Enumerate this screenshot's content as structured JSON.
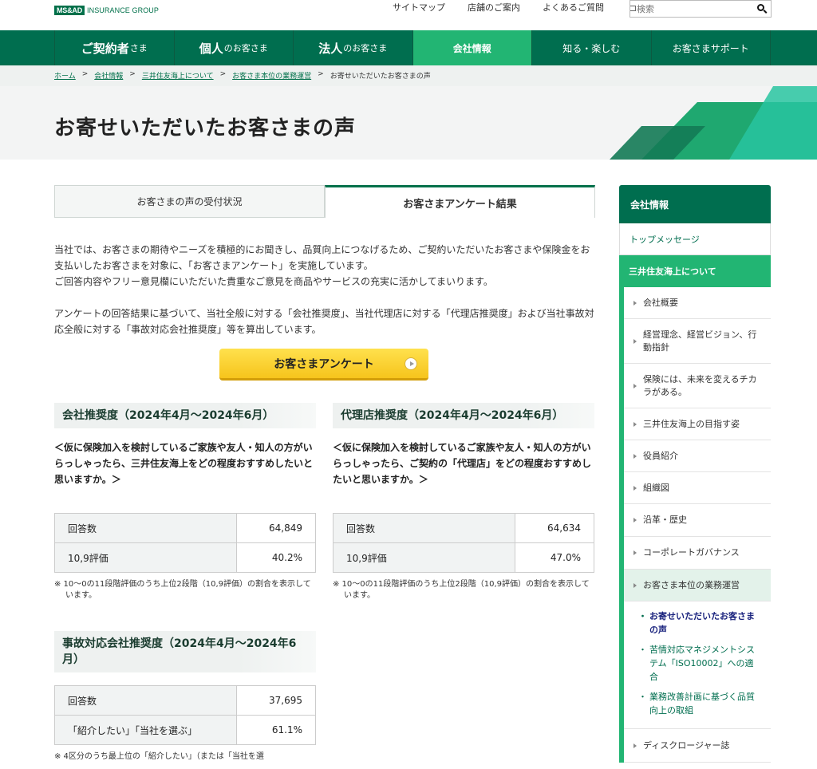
{
  "header": {
    "logo_box": "MS&AD",
    "logo_text": "INSURANCE GROUP",
    "util_links": [
      "サイトマップ",
      "店舗のご案内",
      "よくあるご質問"
    ],
    "search_placeholder": "検索"
  },
  "gnav": [
    {
      "main": "ご契約者",
      "suffix": "さま"
    },
    {
      "main": "個人",
      "suffix": "のお客さま"
    },
    {
      "main": "法人",
      "suffix": "のお客さま"
    },
    {
      "main": "会社情報",
      "suffix": ""
    },
    {
      "main": "知る・楽しむ",
      "suffix": ""
    },
    {
      "main": "お客さまサポート",
      "suffix": ""
    }
  ],
  "breadcrumb": {
    "links": [
      "ホーム",
      "会社情報",
      "三井住友海上について",
      "お客さま本位の業務運営"
    ],
    "current": "お寄せいただいたお客さまの声"
  },
  "page_title": "お寄せいただいたお客さまの声",
  "tabs": {
    "tab1": "お客さまの声の受付状況",
    "tab2": "お客さまアンケート結果"
  },
  "intro": {
    "p1a": "当社では、お客さまの期待やニーズを積極的にお聞きし、品質向上につなげるため、ご契約いただいたお客さまや保険金をお支払いしたお客さまを対象に、「お客さまアンケート」を実施しています。",
    "p1b": "ご回答内容やフリー意見欄にいただいた貴重なご意見を商品やサービスの充実に活かしてまいります。",
    "p2": "アンケートの回答結果に基づいて、当社全般に対する「会社推奨度」、当社代理店に対する「代理店推奨度」および当社事故対応全般に対する「事故対応会社推奨度」等を算出しています。"
  },
  "cta_label": "お客さまアンケート",
  "blocks": {
    "company": {
      "title": "会社推奨度（2024年4月～2024年6月）",
      "question": "＜仮に保険加入を検討しているご家族や友人・知人の方がいらっしゃったら、三井住友海上をどの程度おすすめしたいと思いますか。＞",
      "row1_label": "回答数",
      "row1_value": "64,849",
      "row2_label": "10,9評価",
      "row2_value": "40.2%",
      "note": "※ 10～0の11段階評価のうち上位2段階（10,9評価）の割合を表示しています。"
    },
    "agency": {
      "title": "代理店推奨度（2024年4月～2024年6月）",
      "question": "＜仮に保険加入を検討しているご家族や友人・知人の方がいらっしゃったら、ご契約の「代理店」をどの程度おすすめしたいと思いますか。＞",
      "row1_label": "回答数",
      "row1_value": "64,634",
      "row2_label": "10,9評価",
      "row2_value": "47.0%",
      "note": "※ 10～0の11段階評価のうち上位2段階（10,9評価）の割合を表示しています。"
    },
    "accident": {
      "title": "事故対応会社推奨度（2024年4月～2024年6月）",
      "row1_label": "回答数",
      "row1_value": "37,695",
      "row2_label": "「紹介したい」「当社を選ぶ」",
      "row2_value": "61.1%",
      "note": "※ 4区分のうち最上位の「紹介したい」（または「当社を選"
    }
  },
  "sidebar": {
    "head": "会社情報",
    "top": "トップメッセージ",
    "section": "三井住友海上について",
    "items": [
      "会社概要",
      "経営理念、経営ビジョン、行動指針",
      "保険には、未来を変えるチカラがある。",
      "三井住友海上の目指す姿",
      "役員紹介",
      "組織図",
      "沿革・歴史",
      "コーポレートガバナンス",
      "お客さま本位の業務運営"
    ],
    "sub": [
      "お寄せいただいたお客さまの声",
      "苦情対応マネジメントシステム「ISO10002」への適合",
      "業務改善計画に基づく品質向上の取組"
    ],
    "last": "ディスクロージャー誌"
  }
}
